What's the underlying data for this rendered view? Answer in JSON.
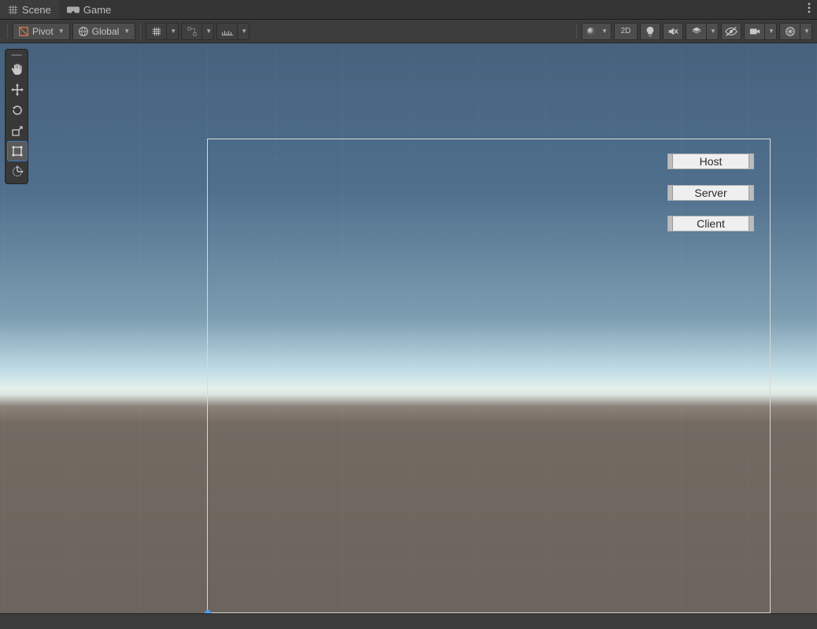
{
  "tabs": {
    "scene": "Scene",
    "game": "Game"
  },
  "toolbar": {
    "pivot_label": "Pivot",
    "global_label": "Global",
    "twoD_label": "2D"
  },
  "tools": {
    "hand": "hand-tool",
    "move": "move-tool",
    "rotate": "rotate-tool",
    "scale": "scale-tool",
    "rect": "rect-tool",
    "transform": "transform-tool"
  },
  "canvas": {
    "buttons": [
      {
        "label": "Host"
      },
      {
        "label": "Server"
      },
      {
        "label": "Client"
      }
    ]
  }
}
